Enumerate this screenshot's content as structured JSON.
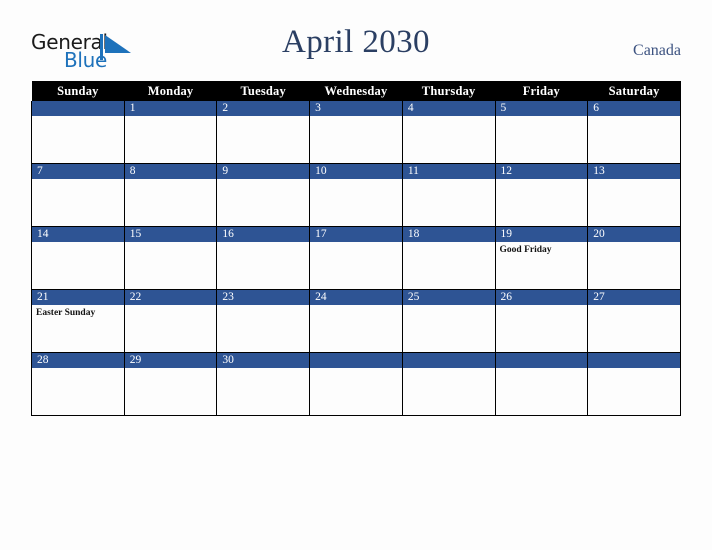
{
  "brand": {
    "name_part1": "General",
    "name_part2": "Blue",
    "mark_icon": "blue-triangle-logo-mark"
  },
  "header": {
    "title": "April 2030",
    "region": "Canada"
  },
  "colors": {
    "header_bar": "#000000",
    "day_band": "#2e5494",
    "title_text": "#2b3f63",
    "brand_blue": "#1e72bb",
    "page_background": "#fdfdfd",
    "cell_background": "#fdfdfd",
    "grid_line": "#000000"
  },
  "calendar": {
    "month": "April",
    "year": "2030",
    "weekday_headers": [
      "Sunday",
      "Monday",
      "Tuesday",
      "Wednesday",
      "Thursday",
      "Friday",
      "Saturday"
    ],
    "weeks": [
      [
        {
          "day": "",
          "events": []
        },
        {
          "day": "1",
          "events": []
        },
        {
          "day": "2",
          "events": []
        },
        {
          "day": "3",
          "events": []
        },
        {
          "day": "4",
          "events": []
        },
        {
          "day": "5",
          "events": []
        },
        {
          "day": "6",
          "events": []
        }
      ],
      [
        {
          "day": "7",
          "events": []
        },
        {
          "day": "8",
          "events": []
        },
        {
          "day": "9",
          "events": []
        },
        {
          "day": "10",
          "events": []
        },
        {
          "day": "11",
          "events": []
        },
        {
          "day": "12",
          "events": []
        },
        {
          "day": "13",
          "events": []
        }
      ],
      [
        {
          "day": "14",
          "events": []
        },
        {
          "day": "15",
          "events": []
        },
        {
          "day": "16",
          "events": []
        },
        {
          "day": "17",
          "events": []
        },
        {
          "day": "18",
          "events": []
        },
        {
          "day": "19",
          "events": [
            "Good Friday"
          ]
        },
        {
          "day": "20",
          "events": []
        }
      ],
      [
        {
          "day": "21",
          "events": [
            "Easter Sunday"
          ]
        },
        {
          "day": "22",
          "events": []
        },
        {
          "day": "23",
          "events": []
        },
        {
          "day": "24",
          "events": []
        },
        {
          "day": "25",
          "events": []
        },
        {
          "day": "26",
          "events": []
        },
        {
          "day": "27",
          "events": []
        }
      ],
      [
        {
          "day": "28",
          "events": []
        },
        {
          "day": "29",
          "events": []
        },
        {
          "day": "30",
          "events": []
        },
        {
          "day": "",
          "events": []
        },
        {
          "day": "",
          "events": []
        },
        {
          "day": "",
          "events": []
        },
        {
          "day": "",
          "events": []
        }
      ]
    ]
  }
}
